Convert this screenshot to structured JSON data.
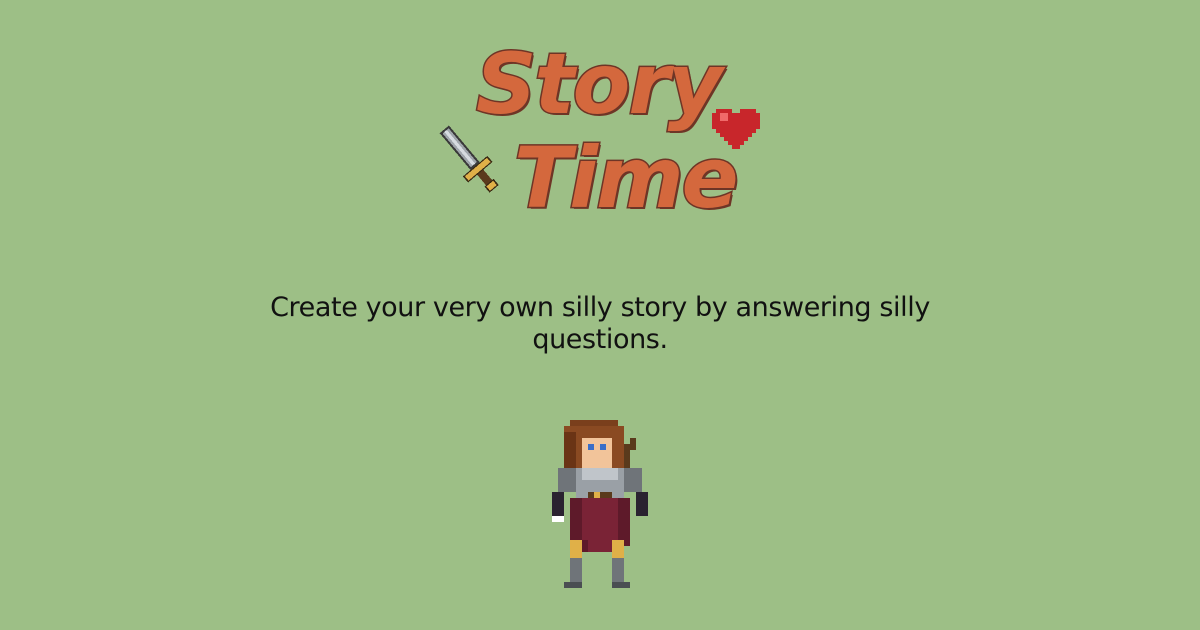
{
  "page": {
    "logo_line1": "Story",
    "logo_line2": "Time",
    "tagline": "Create your very own silly story by answering silly questions."
  },
  "icons": {
    "sword": "sword-icon",
    "heart": "heart-icon",
    "character": "warrior-character"
  },
  "colors": {
    "background": "#9dbf86",
    "logo_fill": "#d4683d",
    "logo_outline": "#6e3526",
    "text": "#111111",
    "heart": "#c8262b"
  }
}
